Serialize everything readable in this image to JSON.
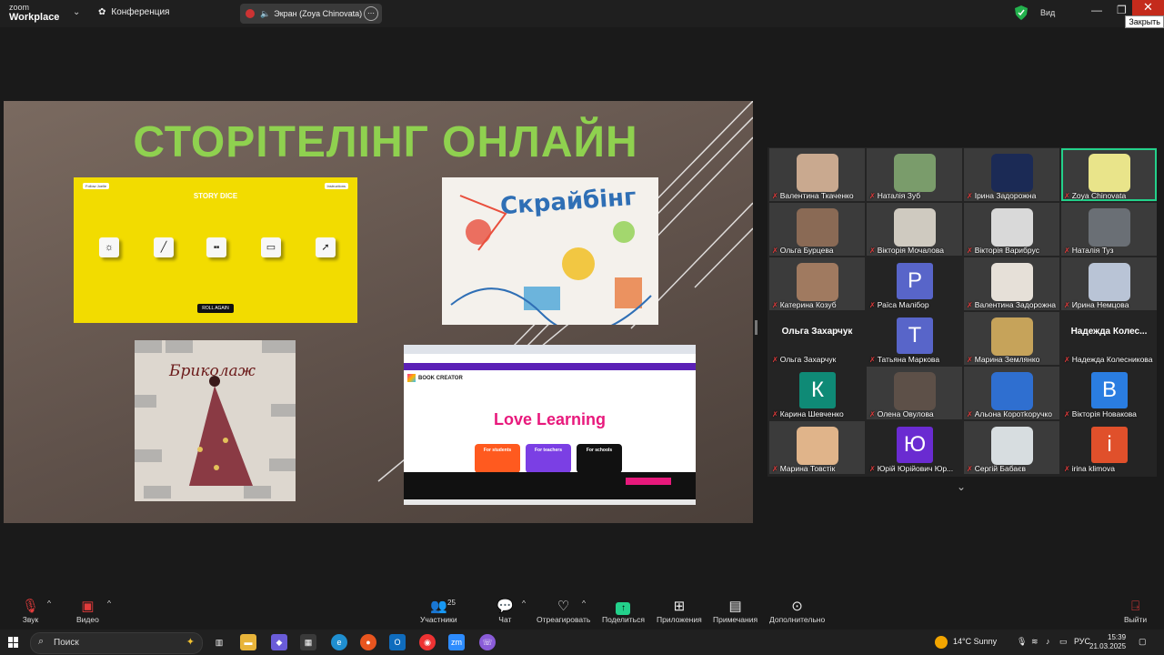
{
  "titlebar": {
    "logo_line1": "zoom",
    "logo_line2": "Workplace",
    "conference": "Конференция",
    "screen_share_label": "Экран (Zoya Chinovata)",
    "view_label": "Вид",
    "close_tooltip": "Закрыть"
  },
  "slide": {
    "title": "СТОРІТЕЛІНГ ОНЛАЙН",
    "story_dice": {
      "title": "STORY DICE",
      "btn_left": "Follow Joelle",
      "btn_right": "Instructions",
      "roll_button": "ROLL AGAIN"
    },
    "scribe_title": "Скрайбінг",
    "brico_title": "Бриколаж",
    "book_creator": {
      "logo": "BOOK CREATOR",
      "headline": "Love Learning",
      "card_students": "For students",
      "card_teachers": "For teachers",
      "card_schools": "For schools"
    }
  },
  "gallery": {
    "tiles": [
      {
        "name": "Валентина Ткаченко",
        "type": "video",
        "color": "#c9a98f"
      },
      {
        "name": "Наталія Зуб",
        "type": "video",
        "color": "#7a9c6b"
      },
      {
        "name": "Ірина Задорожна",
        "type": "video",
        "color": "#1b2a55"
      },
      {
        "name": "Zoya Chinovata",
        "type": "video",
        "color": "#e9e48a"
      },
      {
        "name": "Ольга Бурцева",
        "type": "video",
        "color": "#8a6a55"
      },
      {
        "name": "Вікторія Мочалова",
        "type": "video",
        "color": "#cfcac0"
      },
      {
        "name": "Вікторія Варибрус",
        "type": "video",
        "color": "#d9d9d9"
      },
      {
        "name": "Наталія Туз",
        "type": "video",
        "color": "#6a6f75"
      },
      {
        "name": "Катерина Козуб",
        "type": "video",
        "color": "#a07a60"
      },
      {
        "name": "Раїса Малібор",
        "type": "avatar",
        "letter": "Р",
        "color": "#5865c9"
      },
      {
        "name": "Валентина Задорожна",
        "type": "video",
        "color": "#e6e0d8"
      },
      {
        "name": "Ирина Немцова",
        "type": "video",
        "color": "#b9c4d6"
      },
      {
        "name": "Ольга Захарчук",
        "type": "name",
        "big": "Ольга Захарчук"
      },
      {
        "name": "Татьяна Маркова",
        "type": "avatar",
        "letter": "Т",
        "color": "#5865c9"
      },
      {
        "name": "Марина Землянко",
        "type": "video",
        "color": "#c6a35a"
      },
      {
        "name": "Надежда Колесникова",
        "type": "name",
        "big": "Надежда  Колес..."
      },
      {
        "name": "Карина Шевченко",
        "type": "avatar",
        "letter": "К",
        "color": "#0f8a76"
      },
      {
        "name": "Олена Овулова",
        "type": "video",
        "color": "#5d5048"
      },
      {
        "name": "Альона Коротkоручко",
        "type": "video",
        "color": "#2f6fd0"
      },
      {
        "name": "Вікторія Новакова",
        "type": "avatar",
        "letter": "В",
        "color": "#2a7de1"
      },
      {
        "name": "Марина Товстік",
        "type": "video",
        "color": "#e0b48a"
      },
      {
        "name": "Юрій Юрійович Юр...",
        "type": "avatar",
        "letter": "Ю",
        "color": "#6a2bd1"
      },
      {
        "name": "Сергій Бабаєв",
        "type": "video",
        "color": "#d7dde0"
      },
      {
        "name": "irina klimova",
        "type": "avatar",
        "letter": "i",
        "color": "#e0502b"
      }
    ]
  },
  "toolbar": {
    "audio": "Звук",
    "video": "Видео",
    "participants": "Участники",
    "participants_count": "25",
    "chat": "Чат",
    "react": "Отреагировать",
    "share": "Поделиться",
    "apps": "Приложения",
    "notes": "Примечания",
    "more": "Дополнительно",
    "leave": "Выйти"
  },
  "taskbar": {
    "search": "Поиск",
    "weather": "14°C  Sunny",
    "lang": "РУС",
    "time": "15:39",
    "date": "21.03.2025"
  }
}
